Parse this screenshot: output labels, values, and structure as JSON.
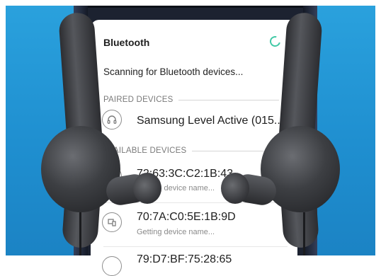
{
  "header": {
    "title": "Bluetooth"
  },
  "status": {
    "scanning_text": "Scanning for Bluetooth devices..."
  },
  "sections": {
    "paired": "PAIRED DEVICES",
    "available": "AVAILABLE DEVICES"
  },
  "paired_devices": [
    {
      "name": "Samsung Level Active (015..",
      "icon": "headphones-icon"
    }
  ],
  "available_devices": [
    {
      "name": "72:63:3C:C2:1B:43",
      "sub": "Getting device name...",
      "icon": "bluetooth-device-icon"
    },
    {
      "name": "70:7A:C0:5E:1B:9D",
      "sub": "Getting device name...",
      "icon": "bluetooth-device-icon"
    },
    {
      "name": "79:D7:BF:75:28:65",
      "sub": "",
      "icon": "bluetooth-device-icon"
    }
  ],
  "colors": {
    "background": "#1f8fd0",
    "spinner": "#41c9a6",
    "earbuds": "#3d3f43"
  }
}
